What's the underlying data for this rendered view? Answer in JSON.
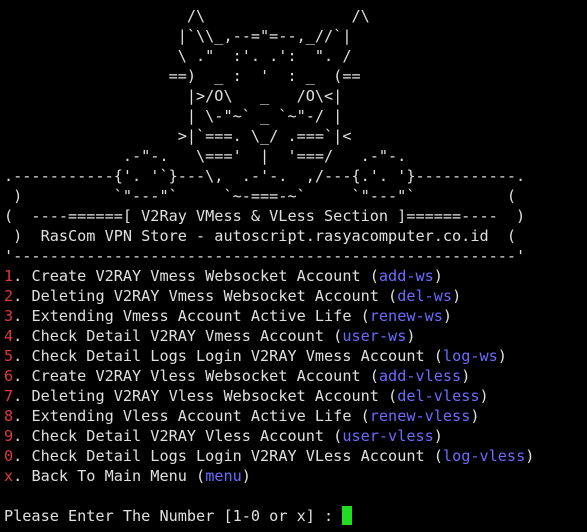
{
  "art": [
    "                    /\\                /\\",
    "                   |`\\\\_,--=\"=--,_//`|",
    "                   \\ .\"  :'. .':  \". /",
    "                  ==)  _ :  '  : _  (==",
    "                    |>/O\\   _   /O\\<|",
    "                    | \\-\"~` _ `~\"-/ |",
    "                   >|`===. \\_/ .===`|<",
    "             .-\"-.   \\==='  |  '===/   .-\"-.",
    ".-----------{'. '`}---\\,  .-'-.  ,/---{.'. '}-----------.",
    " )          `\"---\"`     `~-===-~`     `\"---\"`          (",
    "(  ----======[ V2Ray VMess & VLess Section ]======----  )",
    " )  RasCom VPN Store - autoscript.rasyacomputer.co.id  (",
    "'-------------------------------------------------------'"
  ],
  "menu": [
    {
      "num": "1",
      "label": ". Create V2RAY Vmess Websocket Account (",
      "cmd": "add-ws",
      "end": ")"
    },
    {
      "num": "2",
      "label": ". Deleting V2RAY Vmess Websocket Account (",
      "cmd": "del-ws",
      "end": ")"
    },
    {
      "num": "3",
      "label": ". Extending Vmess Account Active Life (",
      "cmd": "renew-ws",
      "end": ")"
    },
    {
      "num": "4",
      "label": ". Check Detail V2RAY Vmess Account (",
      "cmd": "user-ws",
      "end": ")"
    },
    {
      "num": "5",
      "label": ". Check Detail Logs Login V2RAY Vmess Account (",
      "cmd": "log-ws",
      "end": ")"
    },
    {
      "num": "6",
      "label": ". Create V2RAY Vless Websocket Account (",
      "cmd": "add-vless",
      "end": ")"
    },
    {
      "num": "7",
      "label": ". Deleting V2RAY Vless Websocket Account (",
      "cmd": "del-vless",
      "end": ")"
    },
    {
      "num": "8",
      "label": ". Extending Vless Account Active Life (",
      "cmd": "renew-vless",
      "end": ")"
    },
    {
      "num": "9",
      "label": ". Check Detail V2RAY Vless Account (",
      "cmd": "user-vless",
      "end": ")"
    },
    {
      "num": "0",
      "label": ". Check Detail Logs Login V2RAY VLess Account (",
      "cmd": "log-vless",
      "end": ")"
    },
    {
      "num": "x",
      "label": ". Back To Main Menu (",
      "cmd": "menu",
      "end": ")"
    }
  ],
  "prompt": "Please Enter The Number [1-0 or x] : ",
  "colors": {
    "background": "#000000",
    "text": "#e0e0e0",
    "number": "#e03a3a",
    "command": "#6b6bff",
    "cursor": "#22dd22"
  }
}
